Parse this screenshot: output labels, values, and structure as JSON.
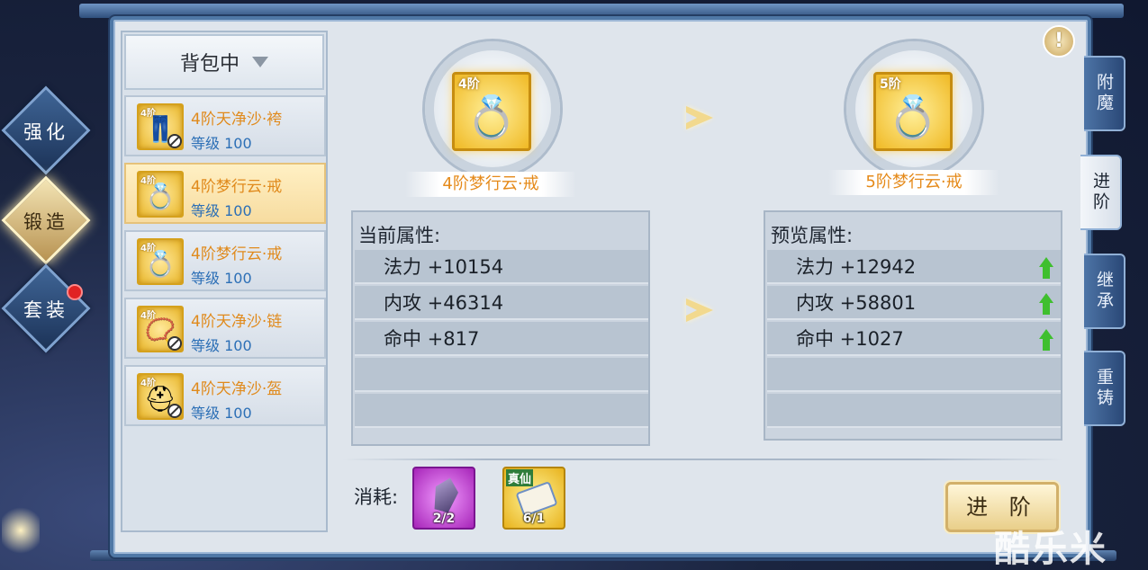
{
  "side_menu": [
    {
      "label": "强化",
      "active": false
    },
    {
      "label": "锻造",
      "active": true
    },
    {
      "label": "套装",
      "active": false,
      "badge": true
    }
  ],
  "bag": {
    "dropdown_label": "背包中",
    "items": [
      {
        "level_tag": "4阶",
        "name": "4阶天净沙·袴",
        "level_label": "等级",
        "level": "100",
        "icon": "pants-icon",
        "locked": true,
        "selected": false
      },
      {
        "level_tag": "4阶",
        "name": "4阶梦行云·戒",
        "level_label": "等级",
        "level": "100",
        "icon": "ring-icon",
        "locked": false,
        "selected": true
      },
      {
        "level_tag": "4阶",
        "name": "4阶梦行云·戒",
        "level_label": "等级",
        "level": "100",
        "icon": "ring-icon",
        "locked": false,
        "selected": false
      },
      {
        "level_tag": "4阶",
        "name": "4阶天净沙·链",
        "level_label": "等级",
        "level": "100",
        "icon": "necklace-icon",
        "locked": true,
        "selected": false
      },
      {
        "level_tag": "4阶",
        "name": "4阶天净沙·盔",
        "level_label": "等级",
        "level": "100",
        "icon": "helmet-icon",
        "locked": true,
        "selected": false
      }
    ]
  },
  "current": {
    "level_tag": "4阶",
    "name": "4阶梦行云·戒",
    "header": "当前属性:",
    "stats": [
      "法力 +10154",
      "内攻 +46314",
      "命中 +817"
    ]
  },
  "preview": {
    "level_tag": "5阶",
    "name": "5阶梦行云·戒",
    "header": "预览属性:",
    "stats": [
      "法力 +12942",
      "内攻 +58801",
      "命中 +1027"
    ]
  },
  "cost": {
    "label": "消耗:",
    "items": [
      {
        "icon": "crystal-icon",
        "count": "2/2",
        "color": "#c13cd0"
      },
      {
        "icon": "scroll-icon",
        "count": "6/1",
        "tag": "真仙",
        "color": "#f0c430"
      }
    ]
  },
  "advance_button": "进 阶",
  "right_tabs": [
    {
      "label": "附魔",
      "active": false
    },
    {
      "label": "进阶",
      "active": true
    },
    {
      "label": "继承",
      "active": false
    },
    {
      "label": "重铸",
      "active": false
    }
  ],
  "info_button": "!",
  "watermark": "酷乐米",
  "colors": {
    "item_name": "#e08a1c",
    "item_level": "#2c6fb6",
    "stat_up": "#3fbf2e",
    "frame": "#4f78a6"
  }
}
